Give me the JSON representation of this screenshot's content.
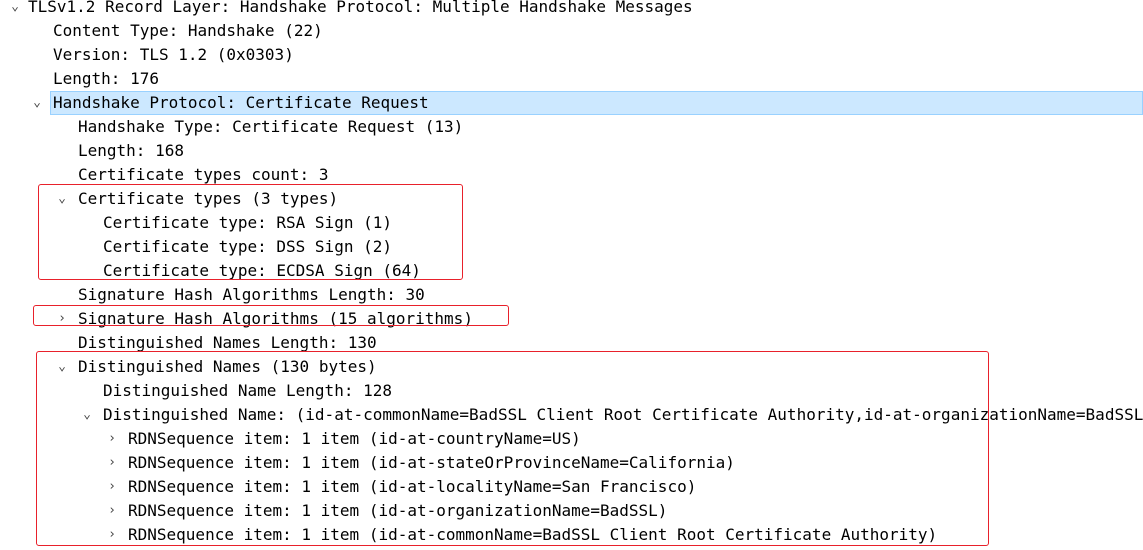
{
  "tree": {
    "record_layer": {
      "toggle": "⌄",
      "label": "TLSv1.2 Record Layer: Handshake Protocol: Multiple Handshake Messages"
    },
    "content_type": "Content Type: Handshake (22)",
    "version": "Version: TLS 1.2 (0x0303)",
    "length": "Length: 176",
    "handshake_protocol": {
      "toggle": "⌄",
      "label": "Handshake Protocol: Certificate Request"
    },
    "handshake_type": "Handshake Type: Certificate Request (13)",
    "handshake_length": "Length: 168",
    "cert_types_count": "Certificate types count: 3",
    "cert_types": {
      "toggle": "⌄",
      "label": "Certificate types (3 types)",
      "items": [
        "Certificate type: RSA Sign (1)",
        "Certificate type: DSS Sign (2)",
        "Certificate type: ECDSA Sign (64)"
      ]
    },
    "sig_hash_length": "Signature Hash Algorithms Length: 30",
    "sig_hash_algorithms": {
      "toggle": "›",
      "label": "Signature Hash Algorithms (15 algorithms)"
    },
    "dn_length": "Distinguished Names Length: 130",
    "distinguished_names": {
      "toggle": "⌄",
      "label": "Distinguished Names (130 bytes)",
      "dn_item_length": "Distinguished Name Length: 128",
      "dn": {
        "toggle": "⌄",
        "label": "Distinguished Name: (id-at-commonName=BadSSL Client Root Certificate Authority,id-at-organizationName=BadSSL,id-at-localityName=San Francisco,id-at-stateOrProvinceName=California,id-at-countryName=US)",
        "rdn_items": [
          {
            "toggle": "›",
            "label": "RDNSequence item: 1 item (id-at-countryName=US)"
          },
          {
            "toggle": "›",
            "label": "RDNSequence item: 1 item (id-at-stateOrProvinceName=California)"
          },
          {
            "toggle": "›",
            "label": "RDNSequence item: 1 item (id-at-localityName=San Francisco)"
          },
          {
            "toggle": "›",
            "label": "RDNSequence item: 1 item (id-at-organizationName=BadSSL)"
          },
          {
            "toggle": "›",
            "label": "RDNSequence item: 1 item (id-at-commonName=BadSSL Client Root Certificate Authority)"
          }
        ]
      }
    }
  },
  "colors": {
    "selection_bg": "#cce8ff",
    "selection_border": "#99d1ff",
    "highlight_box": "#e8212b"
  }
}
